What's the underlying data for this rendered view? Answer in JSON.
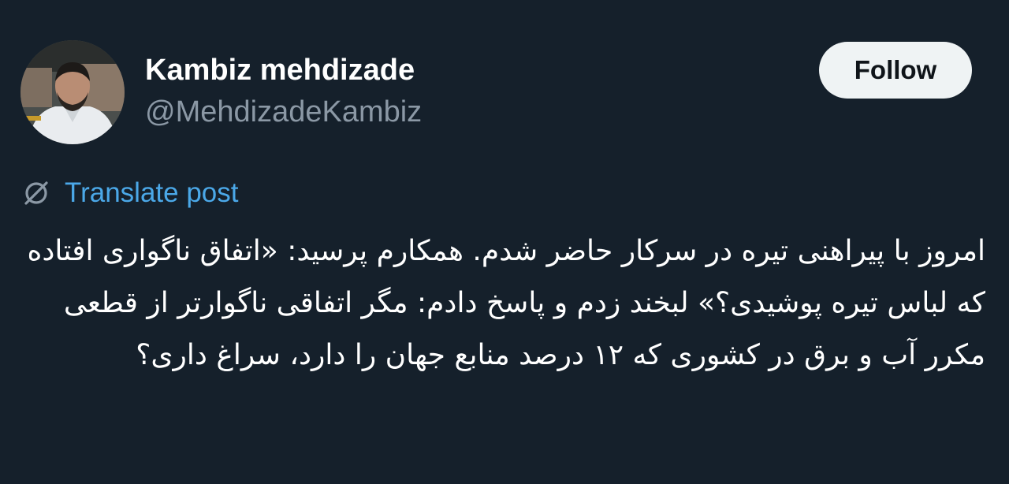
{
  "author": {
    "display_name": "Kambiz mehdizade",
    "handle": "@MehdizadeKambiz",
    "avatar_icon": "profile-photo"
  },
  "actions": {
    "follow_label": "Follow"
  },
  "translate": {
    "icon": "globe-slash-icon",
    "label": "Translate post"
  },
  "post": {
    "text": "امروز با پیراهنی تیره در سرکار حاضر شدم. همکارم پرسید: «اتفاق ناگواری افتاده که لباس تیره پوشیدی؟» لبخند زدم و پاسخ دادم: مگر اتفاقی ناگوارتر از قطعی مکرر آب و برق در کشوری که ۱۲ درصد منابع جهان را دارد، سراغ داری؟"
  },
  "colors": {
    "background": "#15202b",
    "text_primary": "#ffffff",
    "text_secondary": "#8b98a5",
    "link": "#4ba8e8",
    "follow_bg": "#eff3f4",
    "follow_text": "#0f1419"
  }
}
